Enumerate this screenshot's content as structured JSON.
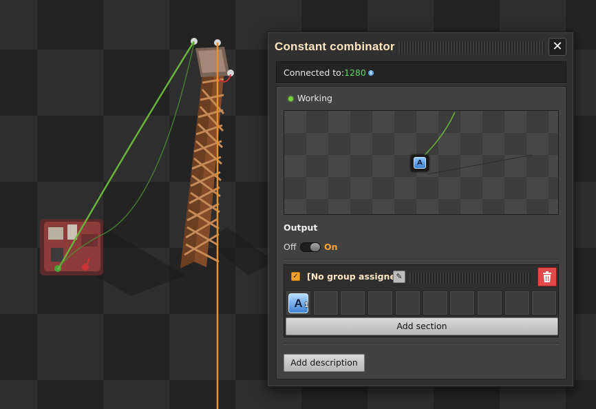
{
  "window": {
    "title": "Constant combinator",
    "close_icon": "close-icon"
  },
  "connection": {
    "label": "Connected to:",
    "network_id": "1280",
    "info_icon": "info-icon"
  },
  "status": {
    "text": "Working",
    "color": "#78d23c"
  },
  "preview": {
    "signal_letter": "A"
  },
  "output": {
    "heading": "Output",
    "off_label": "Off",
    "on_label": "On",
    "state": "On"
  },
  "section": {
    "checked": true,
    "group_label": "[No group assigned]",
    "edit_icon": "pencil-icon",
    "delete_icon": "trash-icon",
    "signals": [
      {
        "letter": "A",
        "count": "1"
      }
    ],
    "empty_slots": 9,
    "add_section_label": "Add section"
  },
  "footer": {
    "add_description_label": "Add description"
  },
  "colors": {
    "title": "#ffe6c0",
    "network_green": "#5fd55f",
    "toggle_on": "#ffa632",
    "delete_red": "#e14a48",
    "green_wire": "#6ab43c",
    "orange_wire": "#e8902a"
  }
}
